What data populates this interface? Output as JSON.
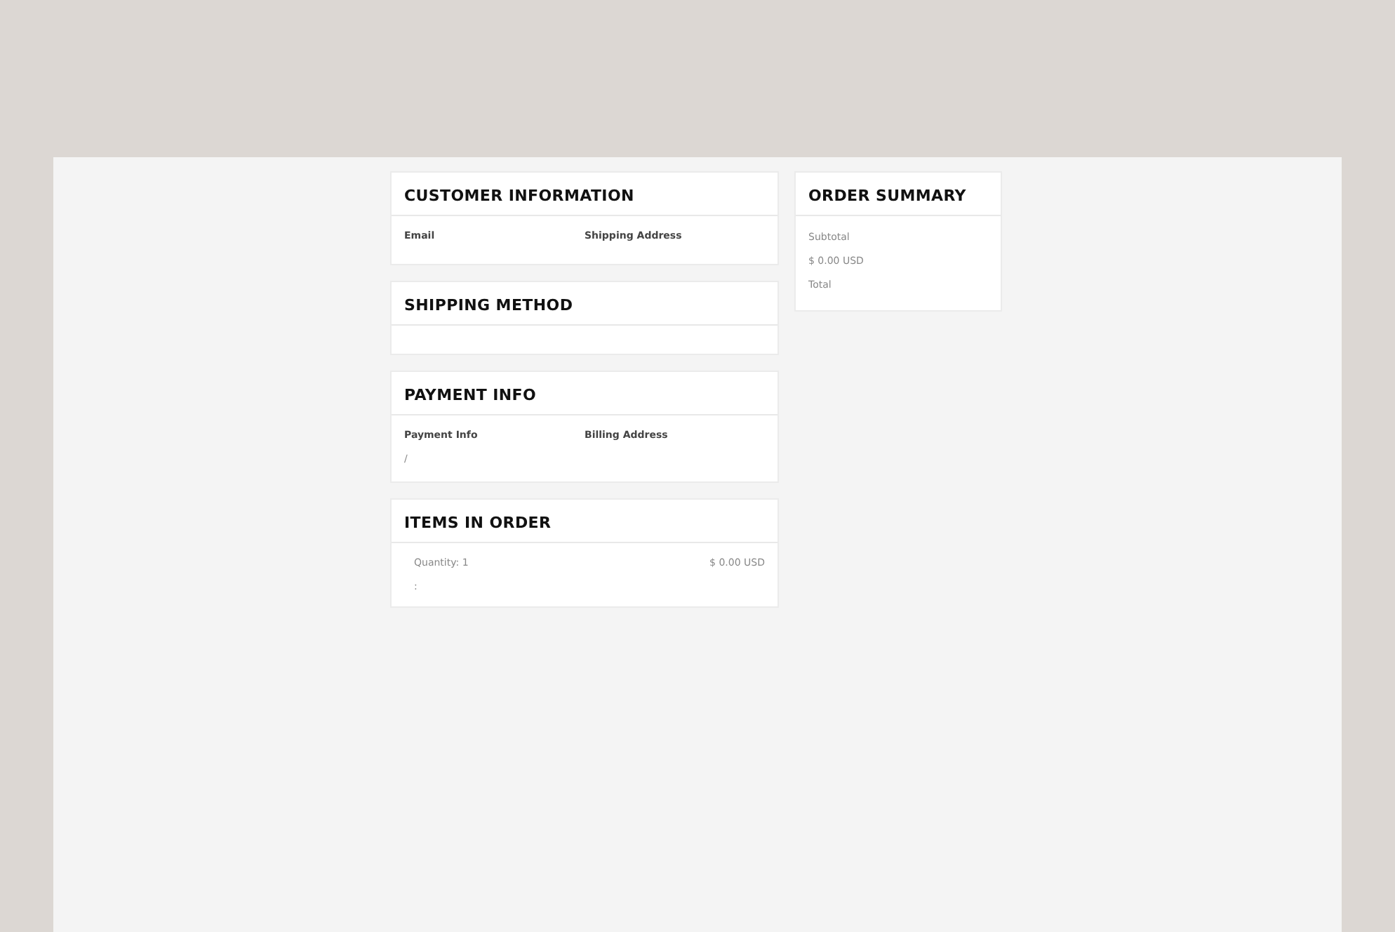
{
  "customer_information": {
    "title": "CUSTOMER INFORMATION",
    "fields": [
      {
        "label": "Email"
      },
      {
        "label": "Shipping Address"
      }
    ]
  },
  "shipping_method": {
    "title": "SHIPPING METHOD"
  },
  "payment_info": {
    "title": "PAYMENT INFO",
    "fields": [
      {
        "label": "Payment Info",
        "value": "/"
      },
      {
        "label": "Billing Address"
      }
    ]
  },
  "items_in_order": {
    "title": "ITEMS IN ORDER",
    "items": [
      {
        "quantity": "Quantity: 1",
        "detail": ":",
        "price": "$ 0.00 USD"
      }
    ]
  },
  "order_summary": {
    "title": "ORDER SUMMARY",
    "lines": [
      "Subtotal",
      "$ 0.00 USD",
      "Total"
    ]
  }
}
